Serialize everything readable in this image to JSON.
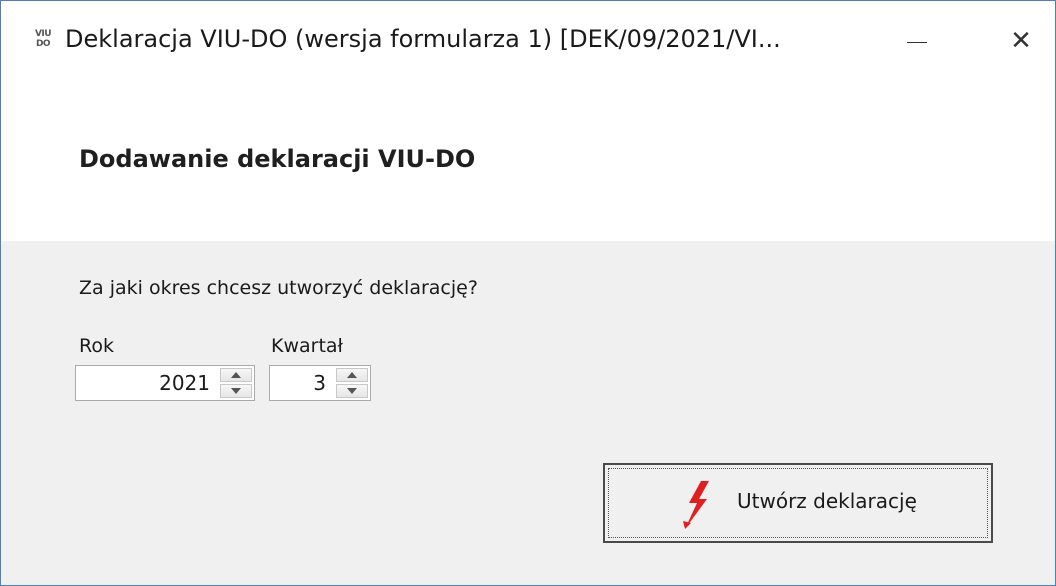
{
  "window": {
    "title": "Deklaracja VIU-DO (wersja formularza 1) [DEK/09/2021/VI...",
    "app_icon_top": "VIU",
    "app_icon_bottom": "DO",
    "minimize_icon": "minimize-icon",
    "close_icon": "close-icon",
    "close_glyph": "✕"
  },
  "header": {
    "title": "Dodawanie deklaracji VIU-DO"
  },
  "form": {
    "question": "Za jaki okres chcesz utworzyć deklarację?",
    "year_label": "Rok",
    "year_value": "2021",
    "quarter_label": "Kwartał",
    "quarter_value": "3"
  },
  "actions": {
    "create_label": "Utwórz deklarację",
    "create_icon": "lightning-icon",
    "create_icon_color": "#e02020"
  }
}
